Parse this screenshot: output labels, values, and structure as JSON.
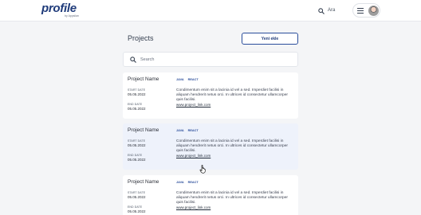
{
  "header": {
    "logo_text": "profile",
    "logo_sub": "by Appsilan",
    "search_label": "Ara",
    "menu_icon": "hamburger-icon",
    "avatar_icon": "user-avatar"
  },
  "page": {
    "title": "Projects",
    "add_button_label": "Yeni ekle",
    "search_placeholder": "Search"
  },
  "projects": [
    {
      "name": "Project Name",
      "tags": [
        "JAVA",
        "REACT"
      ],
      "start_label": "START DATE",
      "start_date": "05.05.2022",
      "end_label": "END DATE",
      "end_date": "05.05.2022",
      "description": "Condimentum enim sit a lacinia id vel a sed. Imperdiet facilisi in aliquam hendrerit netus orci. In ultrices id consectetur ullamcorper quis facilisi.",
      "link": "www.project_link.com"
    },
    {
      "name": "Project Name",
      "tags": [
        "JAVA",
        "REACT"
      ],
      "start_label": "START DATE",
      "start_date": "05.05.2022",
      "end_label": "END DATE",
      "end_date": "05.05.2022",
      "description": "Condimentum enim sit a lacinia id vel a sed. Imperdiet facilisi in aliquam hendrerit netus orci. In ultrices id consectetur ullamcorper quis facilisi.",
      "link": "www.project_link.com"
    },
    {
      "name": "Project Name",
      "tags": [
        "JAVA",
        "REACT"
      ],
      "start_label": "START DATE",
      "start_date": "05.05.2022",
      "end_label": "END DATE",
      "end_date": "05.05.2022",
      "description": "Condimentum enim sit a lacinia id vel a sed. Imperdiet facilisi in aliquam hendrerit netus orci. In ultrices id consectetur ullamcorper quis facilisi.",
      "link": "www.project_link.com"
    }
  ],
  "colors": {
    "brand": "#1f3b7a",
    "accent": "#2a4d9b",
    "highlight_row": "#eef2fb",
    "background": "#f4f5f7"
  }
}
